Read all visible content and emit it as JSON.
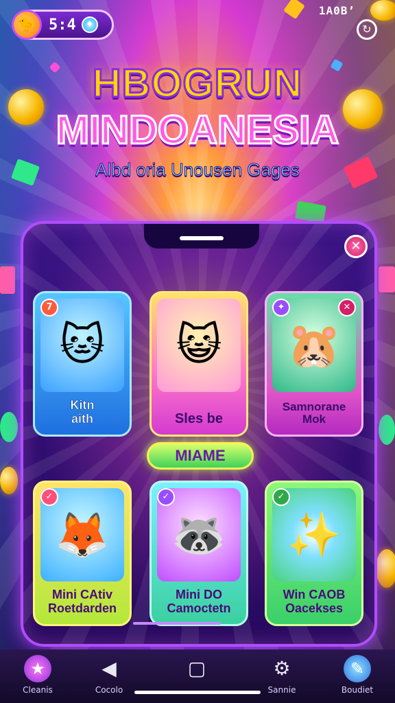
{
  "hud": {
    "value": "5:4",
    "avatar_icon": "duck-avatar-icon",
    "gem_icon": "gem-icon"
  },
  "top_right": {
    "text": "1A0B’",
    "refresh_icon": "refresh-icon"
  },
  "title": {
    "line1": "HBOGRUN",
    "line2": "MINDOANESIA",
    "subtitle": "Albd oria Unousen Gages"
  },
  "cards_top": [
    {
      "label": "Kitn\naith",
      "art": "🐱",
      "badge": "7",
      "has_close": false
    },
    {
      "label": "Sles be",
      "art": "🐱",
      "badge": "",
      "has_close": false
    },
    {
      "label": "Samnorane\nMok",
      "art": "🧑",
      "badge": "✦",
      "has_close": true
    }
  ],
  "mid_button": "MIAME",
  "cards_bottom": [
    {
      "label": "Mini CAtiv\nRoetdarden",
      "art": "🦊",
      "badge": "✓"
    },
    {
      "label": "Mini DO\nCamoctetn",
      "art": "🦊",
      "badge": "✓"
    },
    {
      "label": "Win CAOB\nOacekses",
      "art": "✨",
      "badge": "✓"
    }
  ],
  "nav": [
    {
      "label": "Cleanis",
      "icon": "star-icon"
    },
    {
      "label": "Cocolo",
      "icon": "back-triangle-icon"
    },
    {
      "label": "",
      "icon": "bag-icon"
    },
    {
      "label": "Sannie",
      "icon": "gear-icon"
    },
    {
      "label": "Boudiet",
      "icon": "paint-brush-icon"
    }
  ],
  "colors": {
    "accent_purple": "#b04dff",
    "title_yellow": "#ffd600",
    "title_pink": "#ff5ce6",
    "button_green": "#3fd35a"
  }
}
